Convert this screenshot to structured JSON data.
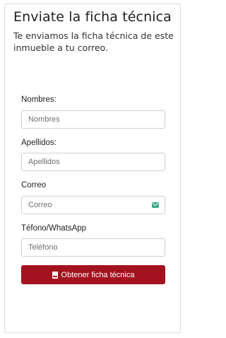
{
  "form": {
    "title": "Enviate la ficha técnica",
    "subtitle": "Te enviamos la ficha técnica de este inmueble a tu correo.",
    "fields": {
      "nombres": {
        "label": "Nombres:",
        "placeholder": "Nombres",
        "value": ""
      },
      "apellidos": {
        "label": "Apellidos:",
        "placeholder": "Apellidos",
        "value": ""
      },
      "correo": {
        "label": "Correo",
        "placeholder": "Correo",
        "value": ""
      },
      "telefono": {
        "label": "Téfono/WhatsApp",
        "placeholder": "Teléfono",
        "value": ""
      }
    },
    "submit_label": "Obtener ficha técnica",
    "submit_icon": "pdf-file-icon",
    "email_icon": "envelope-icon",
    "colors": {
      "accent": "#a3121f",
      "email_icon": "#3fa989"
    }
  }
}
